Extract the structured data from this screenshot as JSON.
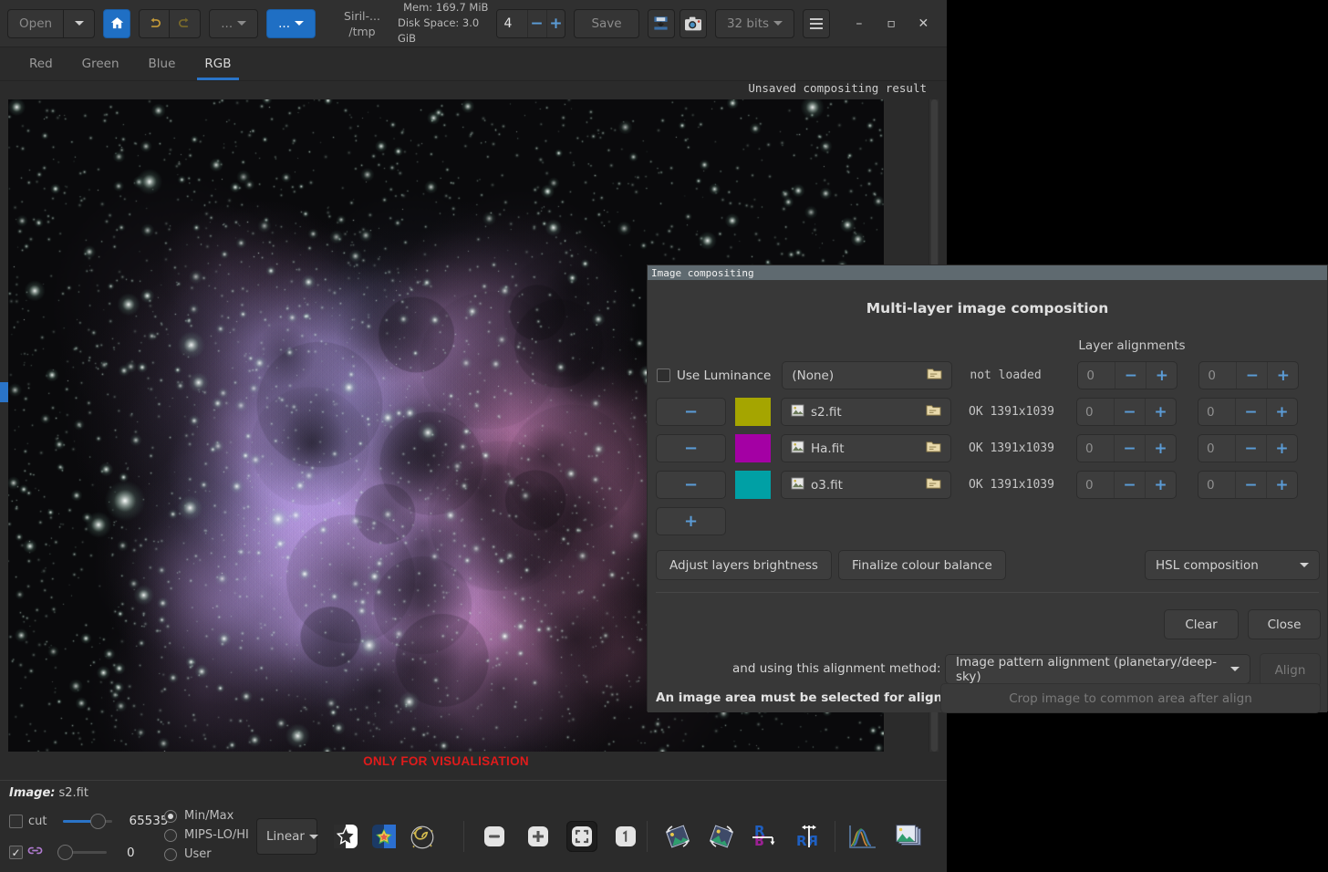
{
  "app": {
    "title_line1": "Siril-...",
    "title_line2": "/tmp"
  },
  "toolbar": {
    "open_label": "Open",
    "open_dropdown_icon": "chevron-down-icon",
    "home_icon": "home-icon",
    "undo_icon": "undo-arrow-icon",
    "redo_icon": "redo-arrow-icon",
    "more_label": "...",
    "more2_label": "...",
    "mem_label": "Mem: 169.7 MiB",
    "disk_label": "Disk Space: 3.0 GiB",
    "zoom_value": "4",
    "minus_label": "−",
    "plus_label": "+",
    "save_label": "Save",
    "save_as_icon": "save-as-icon",
    "snapshot_icon": "camera-snapshot-icon",
    "bitdepth_label": "32 bits",
    "hamburger_icon": "hamburger-menu-icon",
    "minimize_label": "–",
    "maximize_label": "▫",
    "close_label": "✕"
  },
  "tabs": [
    {
      "label": "Red",
      "active": false
    },
    {
      "label": "Green",
      "active": false
    },
    {
      "label": "Blue",
      "active": false
    },
    {
      "label": "RGB",
      "active": true
    }
  ],
  "canvas": {
    "result_label": "Unsaved compositing result",
    "visualisation_note": "ONLY FOR VISUALISATION"
  },
  "status": {
    "image_prefix": "Image:",
    "image_name": "s2.fit",
    "cut_label": "cut",
    "hi_value": "65535",
    "lo_value": "0",
    "link_icon": "chain-link-icon",
    "modes": [
      {
        "label": "Min/Max",
        "selected": true
      },
      {
        "label": "MIPS-LO/HI",
        "selected": false
      },
      {
        "label": "User",
        "selected": false
      }
    ],
    "stretch_label": "Linear",
    "icons": [
      "bw-star-toggle-icon",
      "colour-star-toggle-icon",
      "spiral-galaxy-icon",
      "zoom-out-icon",
      "zoom-in-icon",
      "zoom-fit-icon",
      "zoom-one-to-one-icon",
      "rotate-left-icon",
      "rotate-right-icon",
      "mirror-vertical-icon",
      "mirror-horizontal-icon",
      "histogram-icon",
      "image-stack-icon"
    ]
  },
  "dialog": {
    "window_title": "Image compositing",
    "heading": "Multi-layer image composition",
    "alignments_header": "Layer alignments",
    "luminance": {
      "checkbox_label": "Use Luminance",
      "checked": false,
      "file_label": "(None)",
      "browse_icon": "folder-open-icon",
      "status": "not loaded",
      "align_x": "0",
      "align_y": "0"
    },
    "layers": [
      {
        "remove_label": "−",
        "colour": "#a5a500",
        "thumb_icon": "image-thumbnail-icon",
        "file_label": "s2.fit",
        "browse_icon": "folder-open-icon",
        "status": "OK 1391x1039",
        "align_x": "0",
        "align_y": "0"
      },
      {
        "remove_label": "−",
        "colour": "#a400a4",
        "thumb_icon": "image-thumbnail-icon",
        "file_label": "Ha.fit",
        "browse_icon": "folder-open-icon",
        "status": "OK 1391x1039",
        "align_x": "0",
        "align_y": "0"
      },
      {
        "remove_label": "−",
        "colour": "#00a0a5",
        "thumb_icon": "image-thumbnail-icon",
        "file_label": "o3.fit",
        "browse_icon": "folder-open-icon",
        "status": "OK 1391x1039",
        "align_x": "0",
        "align_y": "0"
      }
    ],
    "add_layer_label": "+",
    "adjust_brightness_label": "Adjust layers brightness",
    "finalize_balance_label": "Finalize colour balance",
    "composition_mode": "HSL composition",
    "clear_label": "Clear",
    "close_label": "Close",
    "align_method_prefix": "and using this alignment method:",
    "align_method_value": "Image pattern alignment (planetary/deep-sky)",
    "align_button_label": "Align",
    "align_warning": "An image area must be selected for align",
    "crop_label": "Crop image to common area after align",
    "minus_label": "−",
    "plus_label": "+"
  },
  "colors": {
    "accent_blue": "#2a74c8",
    "spin_blue": "#5b9bd5",
    "warning_red": "#e01b1b",
    "titlebar": "#5f6a70"
  }
}
